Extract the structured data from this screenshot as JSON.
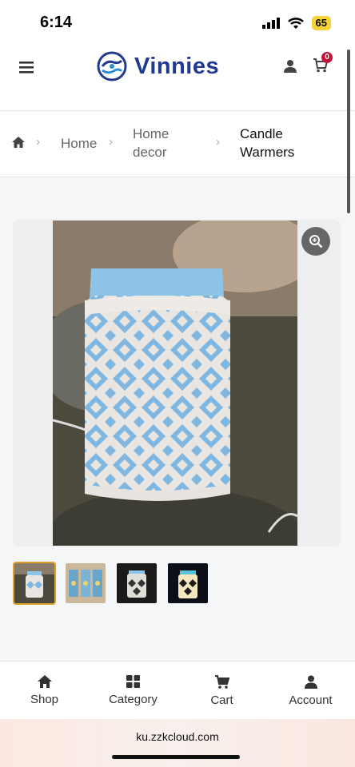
{
  "status_bar": {
    "time": "6:14",
    "battery": "65"
  },
  "header": {
    "brand": "Vinnies",
    "cart_count": "0"
  },
  "breadcrumb": {
    "home": "Home",
    "category_line1": "Home",
    "category_line2": "decor",
    "current_line1": "Candle",
    "current_line2": "Warmers"
  },
  "product": {
    "image_icon": "candle-warmer-photo",
    "thumbnails": [
      "thumb-1",
      "thumb-2",
      "thumb-3",
      "thumb-4"
    ]
  },
  "bottom_nav": {
    "shop": "Shop",
    "category": "Category",
    "cart": "Cart",
    "account": "Account"
  },
  "browser": {
    "url": "ku.zzkcloud.com"
  },
  "colors": {
    "brand": "#213a8f",
    "badge": "#c4123a",
    "active_thumb_border": "#e0a12a"
  }
}
